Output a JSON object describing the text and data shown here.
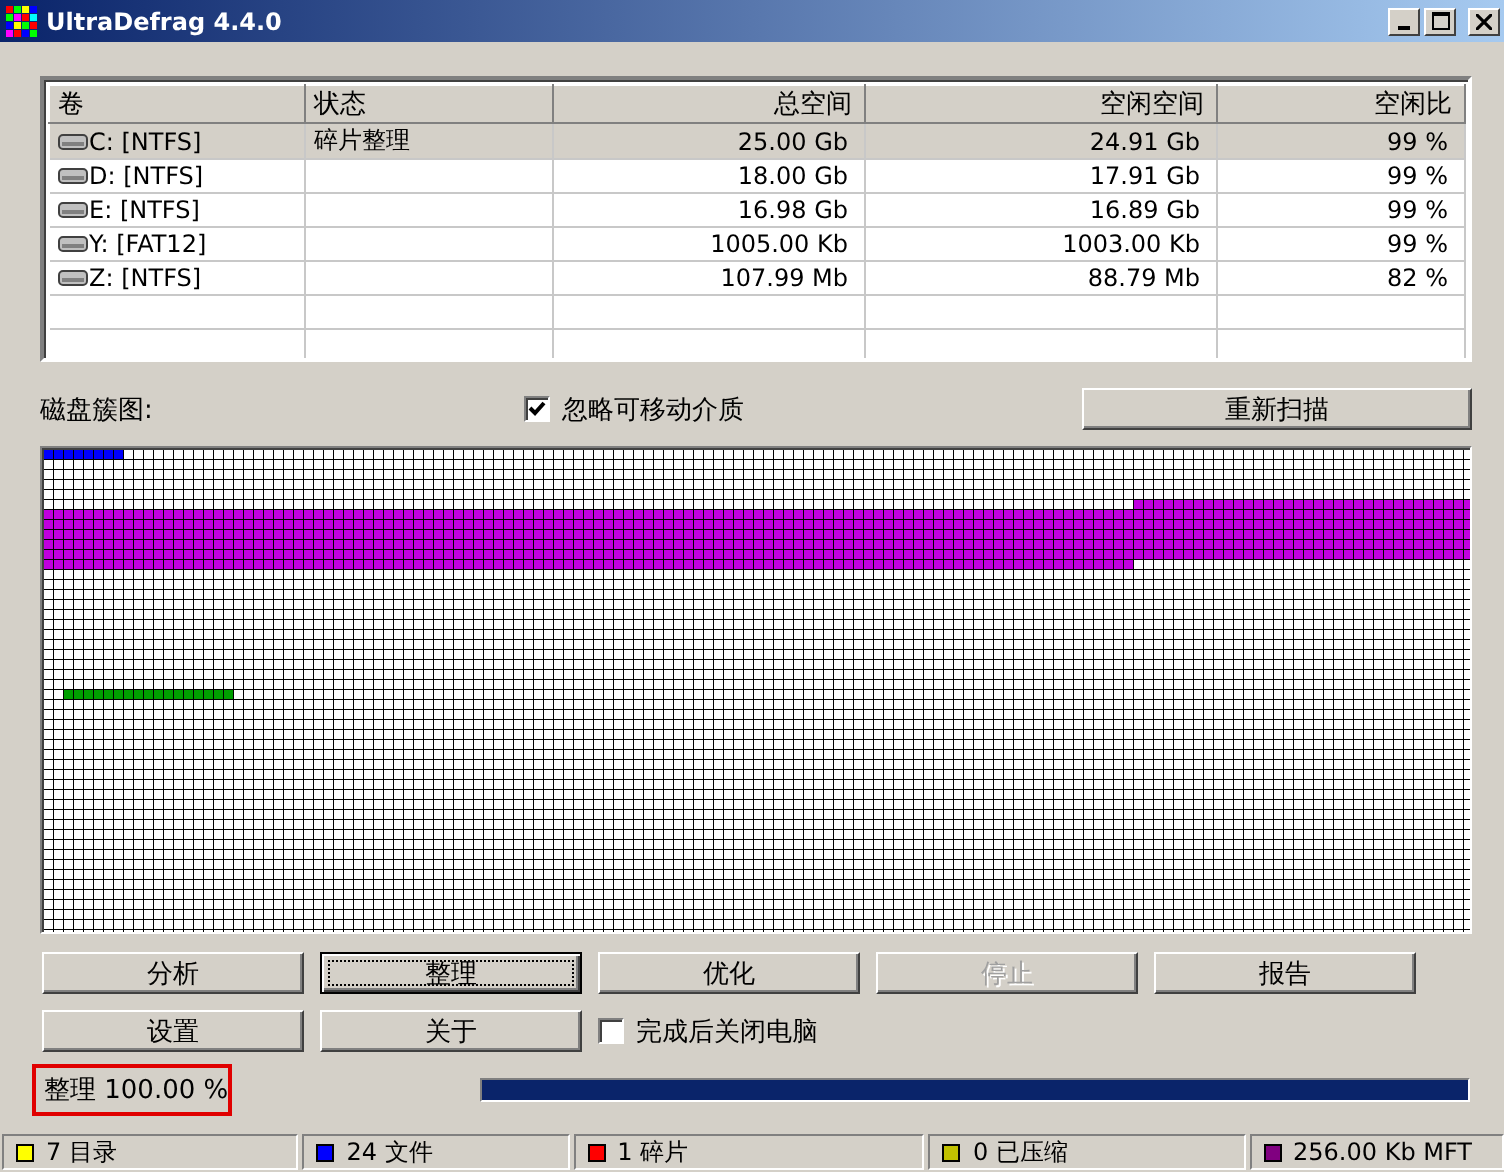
{
  "window": {
    "title": "UltraDefrag 4.4.0"
  },
  "volumes": {
    "columns": [
      "卷",
      "状态",
      "总空间",
      "空闲空间",
      "空闲比"
    ],
    "rows": [
      {
        "volume": "C: [NTFS]",
        "status": "碎片整理",
        "total": "25.00 Gb",
        "free": "24.91 Gb",
        "percent": "99 %",
        "selected": true
      },
      {
        "volume": "D: [NTFS]",
        "total": "18.00 Gb",
        "free": "17.91 Gb",
        "percent": "99 %",
        "selected": false
      },
      {
        "volume": "E: [NTFS]",
        "total": "16.98 Gb",
        "free": "16.89 Gb",
        "percent": "99 %",
        "selected": false
      },
      {
        "volume": "Y: [FAT12]",
        "total": "1005.00 Kb",
        "free": "1003.00 Kb",
        "percent": "99 %",
        "selected": false
      },
      {
        "volume": "Z: [NTFS]",
        "total": "107.99 Mb",
        "free": "88.79 Mb",
        "percent": "82 %",
        "selected": false
      }
    ]
  },
  "cluster_map": {
    "label": "磁盘簇图:",
    "ignore_removable": {
      "label": "忽略可移动介质",
      "checked": true
    },
    "rescan_button": "重新扫描"
  },
  "buttons": [
    {
      "label": "分析",
      "focused": false,
      "disabled": false
    },
    {
      "label": "整理",
      "focused": true,
      "disabled": false
    },
    {
      "label": "优化",
      "focused": false,
      "disabled": false
    },
    {
      "label": "停止",
      "focused": false,
      "disabled": true
    },
    {
      "label": "报告",
      "focused": false,
      "disabled": false
    },
    {
      "label": "设置",
      "focused": false,
      "disabled": false
    },
    {
      "label": "关于",
      "focused": false,
      "disabled": false
    }
  ],
  "shutdown_option": {
    "label": "完成后关闭电脑",
    "checked": false
  },
  "progress": {
    "text": "整理 100.00 %",
    "level": 1
  },
  "status_bar": [
    {
      "text": "7 目录",
      "color": "#ffff00"
    },
    {
      "text": "24 文件",
      "color": "#0000ff"
    },
    {
      "text": "1 碎片",
      "color": "#ff0000"
    },
    {
      "text": "0 已压缩",
      "color": "#c0c000"
    },
    {
      "text": "256.00 Kb MFT",
      "color": "#800080"
    }
  ]
}
